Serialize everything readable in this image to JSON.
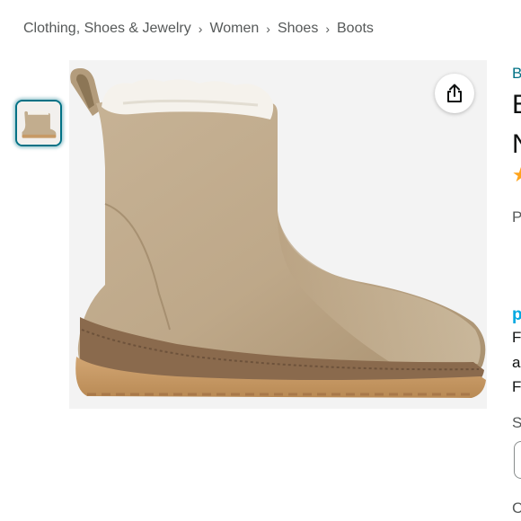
{
  "breadcrumb": {
    "items": [
      "Clothing, Shoes & Jewelry",
      "Women",
      "Shoes",
      "Boots"
    ],
    "separator": "›"
  },
  "product": {
    "image_alt": "Women's shearling-lined suede ankle boot",
    "thumbnail_count": 1
  },
  "icons": {
    "share": "share-icon"
  },
  "right_column_partial": {
    "brand_initial": "B",
    "title_line1_initial": "E",
    "title_line2_initial": "N",
    "rating_star": "★",
    "price_initial": "P",
    "prime_initial": "p",
    "delivery_line1_initial": "F",
    "delivery_line2_initial": "a",
    "delivery_line3_initial": "F",
    "size_label_initial": "S",
    "color_label_initial": "C"
  },
  "colors": {
    "link": "#007185",
    "text": "#0F1111",
    "muted": "#565959",
    "star": "#FFA41C",
    "prime": "#00A8E1",
    "boot_suede": "#c2ad8e",
    "shearling": "#f4f1ea",
    "sole": "#c79a66"
  }
}
